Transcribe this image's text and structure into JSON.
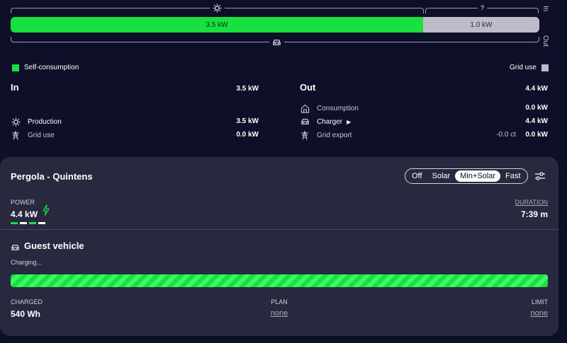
{
  "energyflow": {
    "bar_in": {
      "label": "3.5 kW",
      "share": 0.78
    },
    "bar_grid": {
      "label": "1.0 kW",
      "share": 0.22
    },
    "side_in": "In",
    "side_out": "Out",
    "grid_hint": "?",
    "colors": {
      "self_consumption": "#19e041",
      "grid_use": "#bdbcc8"
    }
  },
  "legend": {
    "self_consumption": "Self-consumption",
    "grid_use": "Grid use"
  },
  "in": {
    "title": "In",
    "total": "3.5 kW",
    "rows": [
      {
        "label": "Production",
        "value": "3.5 kW",
        "icon": "sun-icon"
      },
      {
        "label": "Grid use",
        "value": "0.0 kW",
        "icon": "power-tower-icon"
      }
    ]
  },
  "out": {
    "title": "Out",
    "total": "4.4 kW",
    "rows": [
      {
        "label": "Consumption",
        "value": "0.0 kW",
        "icon": "home-icon"
      },
      {
        "label": "Charger",
        "value": "4.4 kW",
        "icon": "car-icon"
      },
      {
        "label": "Grid export",
        "value": "0.0 kW",
        "extra": "-0.0 ct",
        "icon": "power-tower-icon"
      }
    ]
  },
  "loadpoint": {
    "title": "Pergola - Quintens",
    "modes": [
      "Off",
      "Solar",
      "Min+Solar",
      "Fast"
    ],
    "active_mode": "Min+Solar",
    "power_label": "POWER",
    "power_value": "4.4 kW",
    "duration_label": "DURATION",
    "duration_value": "7:39 m",
    "vehicle": "Guest vehicle",
    "status": "Charging...",
    "progress": 1.0,
    "charged_label": "CHARGED",
    "charged_value": "540 Wh",
    "plan_label": "PLAN",
    "plan_value": "none",
    "limit_label": "LIMIT",
    "limit_value": "none"
  }
}
